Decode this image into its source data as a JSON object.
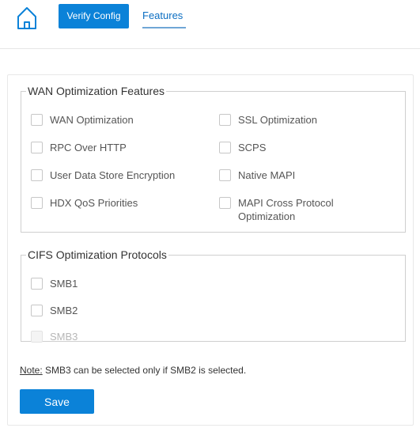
{
  "header": {
    "home_icon": "home-icon",
    "verify_button_label": "Verify Config",
    "features_tab_label": "Features",
    "accent_color": "#0b82d8",
    "link_color": "#0b6ec2"
  },
  "wan_features": {
    "legend": "WAN Optimization Features",
    "items": [
      {
        "label": "WAN Optimization",
        "checked": false
      },
      {
        "label": "SSL Optimization",
        "checked": false
      },
      {
        "label": "RPC Over HTTP",
        "checked": false
      },
      {
        "label": "SCPS",
        "checked": false
      },
      {
        "label": "User Data Store Encryption",
        "checked": false
      },
      {
        "label": "Native MAPI",
        "checked": false
      },
      {
        "label": "HDX QoS Priorities",
        "checked": false
      },
      {
        "label": "MAPI Cross Protocol Optimization",
        "checked": false
      }
    ]
  },
  "cifs_protocols": {
    "legend": "CIFS Optimization Protocols",
    "items": [
      {
        "label": "SMB1",
        "checked": false,
        "enabled": true
      },
      {
        "label": "SMB2",
        "checked": false,
        "enabled": true
      },
      {
        "label": "SMB3",
        "checked": false,
        "enabled": false
      }
    ]
  },
  "note": {
    "prefix": "Note:",
    "text": " SMB3 can be selected only if SMB2 is selected."
  },
  "save_button_label": "Save"
}
